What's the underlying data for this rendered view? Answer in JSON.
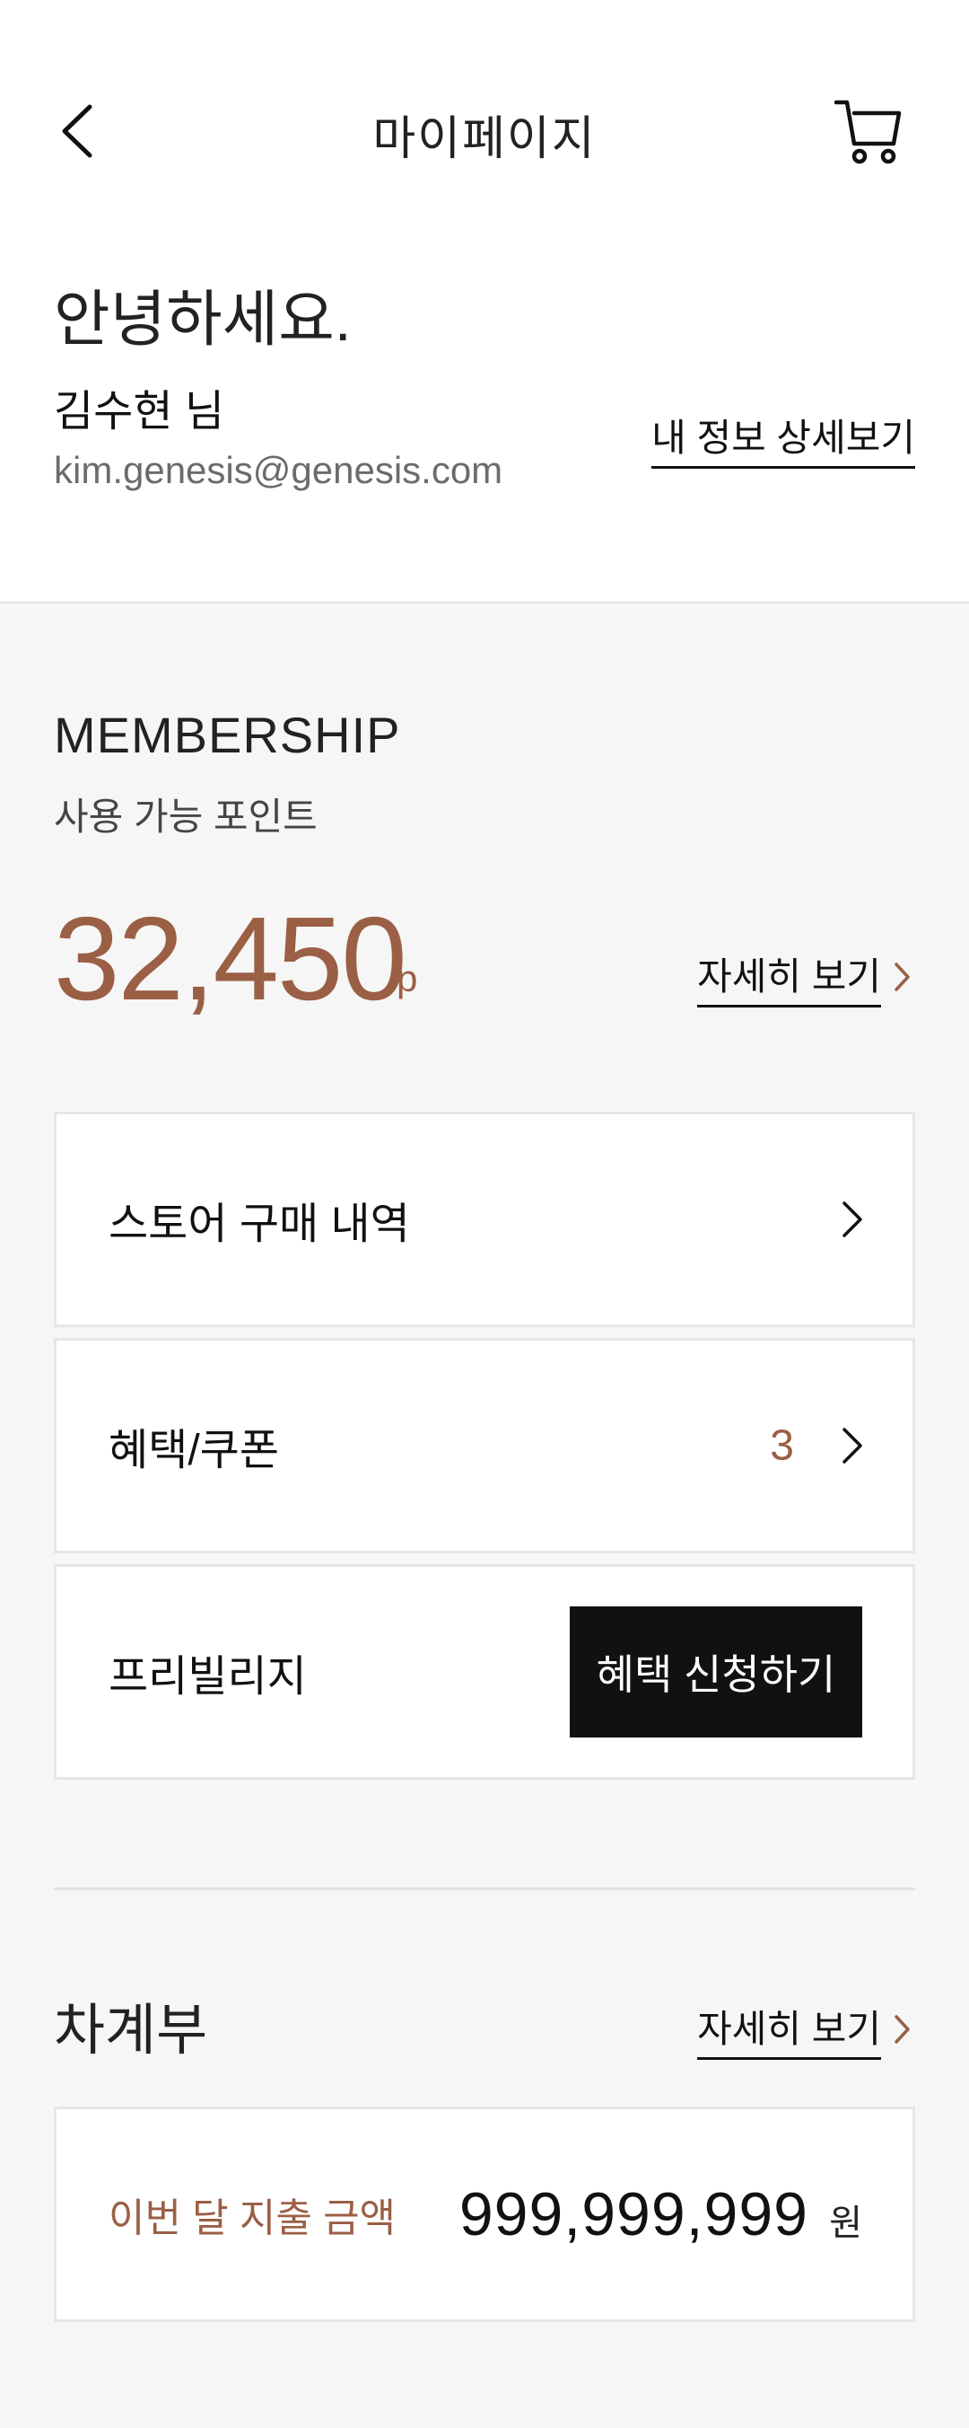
{
  "header": {
    "title": "마이페이지",
    "back_icon": "chevron-left-icon",
    "cart_icon": "cart-icon"
  },
  "profile": {
    "greeting": "안녕하세요.",
    "name": "김수현 님",
    "email": "kim.genesis@genesis.com",
    "detail_link": "내 정보 상세보기"
  },
  "membership": {
    "title": "MEMBERSHIP",
    "points_label": "사용 가능 포인트",
    "points_value": "32,450",
    "points_unit": "p",
    "detail_link": "자세히 보기"
  },
  "menu": {
    "purchase_history": "스토어 구매 내역",
    "coupons": "혜택/쿠폰",
    "coupon_count": "3",
    "privilege": "프리빌리지",
    "apply_button": "혜택 신청하기"
  },
  "ledger": {
    "title": "차계부",
    "detail_link": "자세히 보기",
    "spend_label": "이번 달 지출 금액",
    "spend_amount": "999,999,999",
    "spend_unit": "원"
  },
  "colors": {
    "accent": "#9a5f45",
    "button_bg": "#111111",
    "section_bg": "#f6f6f6"
  }
}
